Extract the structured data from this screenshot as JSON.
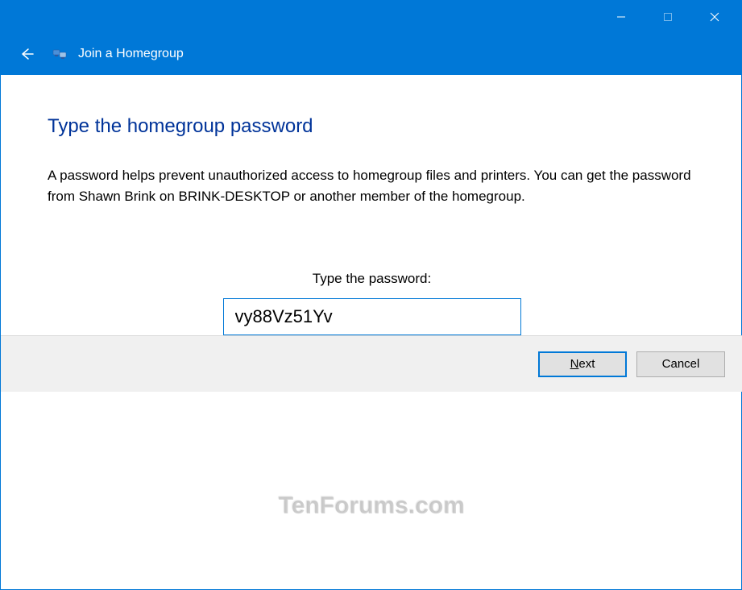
{
  "window": {
    "title": "Join a Homegroup"
  },
  "content": {
    "heading": "Type the homegroup password",
    "description": "A password helps prevent unauthorized access to homegroup files and printers. You can get the password from Shawn Brink on BRINK-DESKTOP or another member of the homegroup.",
    "field_label": "Type the password:",
    "password_value": "vy88Vz51Yv"
  },
  "footer": {
    "next_label": "Next",
    "cancel_label": "Cancel"
  },
  "watermark": "TenForums.com"
}
